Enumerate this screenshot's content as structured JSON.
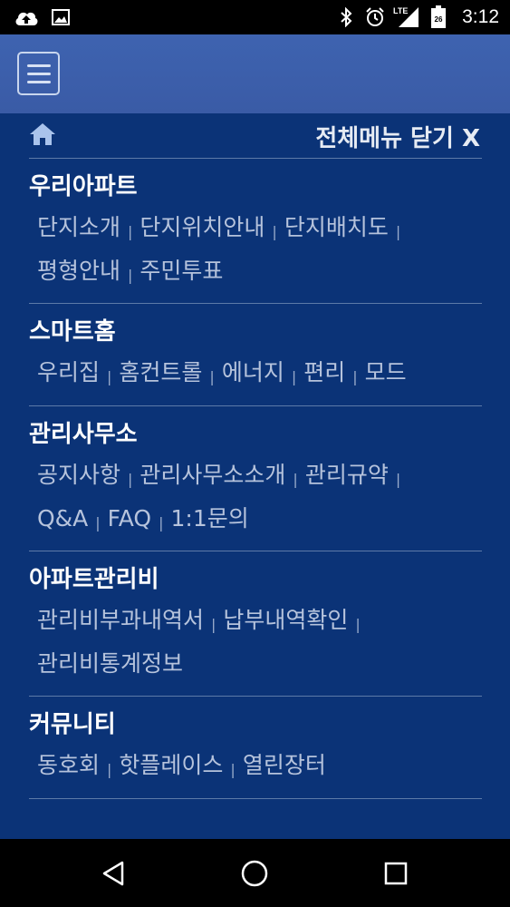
{
  "status_bar": {
    "time": "3:12",
    "network": "LTE",
    "battery_level": "26",
    "icons": [
      "cloud-upload-icon",
      "image-icon",
      "bluetooth-icon",
      "alarm-icon",
      "signal-icon",
      "battery-icon"
    ]
  },
  "app_bar": {
    "menu_icon": "hamburger-icon"
  },
  "menu": {
    "home_icon": "home-icon",
    "close_label": "전체메뉴 닫기 X",
    "separator": "|",
    "sections": [
      {
        "title": "우리아파트",
        "rows": [
          [
            "단지소개",
            "단지위치안내",
            "단지배치도"
          ],
          [
            "평형안내",
            "주민투표"
          ]
        ]
      },
      {
        "title": "스마트홈",
        "rows": [
          [
            "우리집",
            "홈컨트롤",
            "에너지",
            "편리",
            "모드"
          ]
        ]
      },
      {
        "title": "관리사무소",
        "rows": [
          [
            "공지사항",
            "관리사무소소개",
            "관리규약"
          ],
          [
            "Q&A",
            "FAQ",
            "1:1문의"
          ]
        ]
      },
      {
        "title": "아파트관리비",
        "rows": [
          [
            "관리비부과내역서",
            "납부내역확인"
          ],
          [
            "관리비통계정보"
          ]
        ]
      },
      {
        "title": "커뮤니티",
        "rows": [
          [
            "동호회",
            "핫플레이스",
            "열린장터"
          ]
        ]
      }
    ]
  },
  "colors": {
    "background": "#0b3377",
    "app_bar": "#3c60ac",
    "title_text": "#ffffff",
    "link_text": "#b6c3dc",
    "divider": "#5d7aa8"
  },
  "nav_bar": {
    "icons": [
      "back-icon",
      "home-circle-icon",
      "recents-icon"
    ]
  }
}
